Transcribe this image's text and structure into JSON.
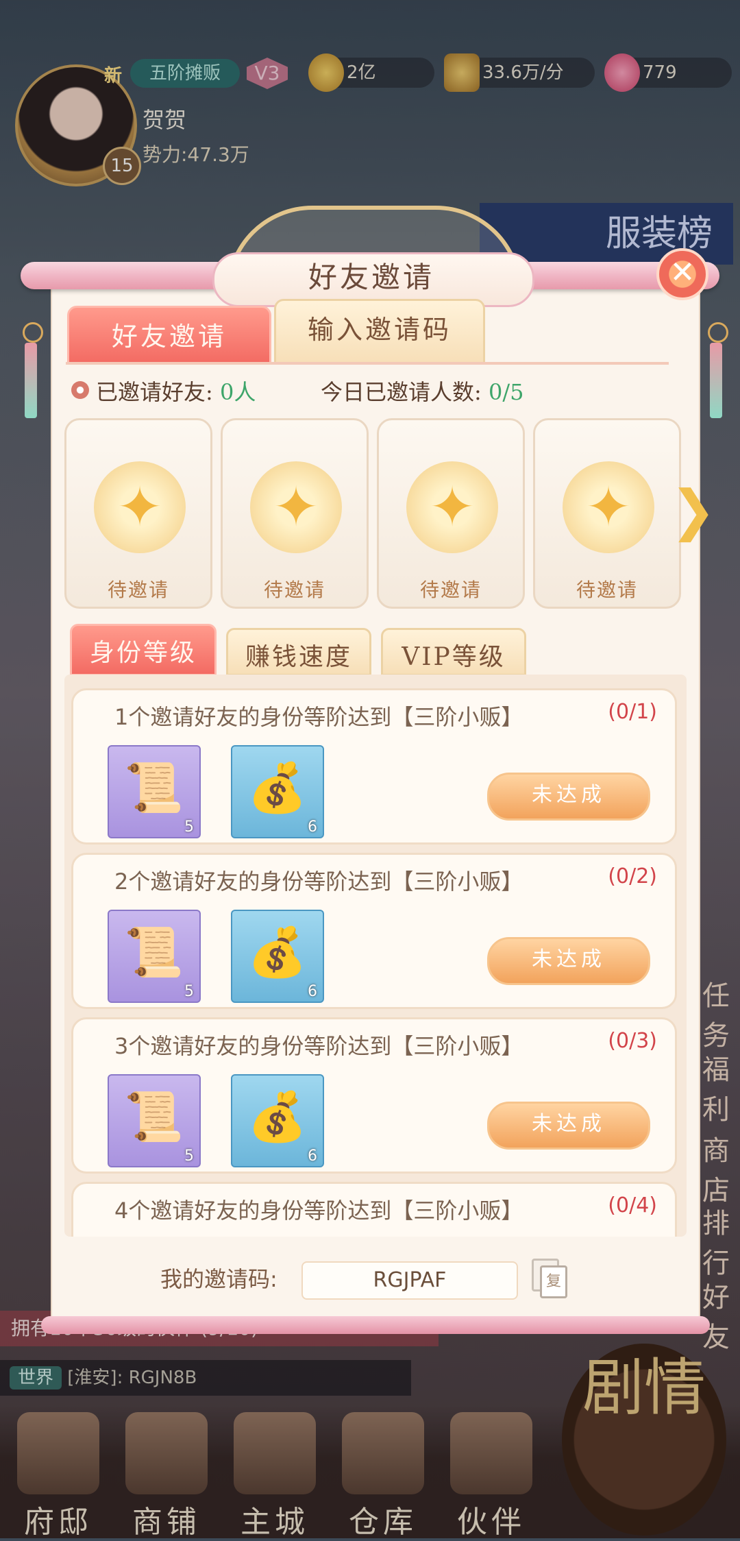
{
  "player": {
    "new_badge": "新",
    "rank": "五阶摊贩",
    "vip": "V3",
    "name": "贺贺",
    "power": "势力:47.3万",
    "level": "15"
  },
  "resources": {
    "silver": "2亿",
    "income": "33.6万/分",
    "gems": "779"
  },
  "background": {
    "banner": "服装榜",
    "task_bar": "拥有10个30级的伙伴 (9/10)",
    "world_tag": "世界",
    "world_message": "[淮安]: RGJN8B",
    "side_menu": [
      "任务",
      "福利",
      "商店",
      "排行",
      "好友"
    ],
    "story_button": "剧情",
    "nav": [
      "府邸",
      "商铺",
      "主城",
      "仓库",
      "伙伴"
    ]
  },
  "modal": {
    "title": "好友邀请",
    "close": "✕",
    "tabs": [
      "好友邀请",
      "输入邀请码"
    ],
    "invited_label": "已邀请好友:",
    "invited_value": "0人",
    "today_label": "今日已邀请人数:",
    "today_value": "0/5",
    "slots": [
      "待邀请",
      "待邀请",
      "待邀请",
      "待邀请"
    ],
    "subtabs": [
      "身份等级",
      "赚钱速度",
      "VIP等级"
    ],
    "tasks": [
      {
        "text": "1个邀请好友的身份等阶达到【三阶小贩】",
        "progress": "(0/1)",
        "scroll_qty": "5",
        "bag_qty": "6",
        "button": "未达成"
      },
      {
        "text": "2个邀请好友的身份等阶达到【三阶小贩】",
        "progress": "(0/2)",
        "scroll_qty": "5",
        "bag_qty": "6",
        "button": "未达成"
      },
      {
        "text": "3个邀请好友的身份等阶达到【三阶小贩】",
        "progress": "(0/3)",
        "scroll_qty": "5",
        "bag_qty": "6",
        "button": "未达成"
      },
      {
        "text": "4个邀请好友的身份等阶达到【三阶小贩】",
        "progress": "(0/4)"
      }
    ],
    "code_label": "我的邀请码:",
    "code_value": "RGJPAF",
    "copy_glyph": "复"
  },
  "colors": {
    "accent_red": "#f36b63",
    "progress_red": "#d2444a",
    "green": "#3ea56a"
  }
}
